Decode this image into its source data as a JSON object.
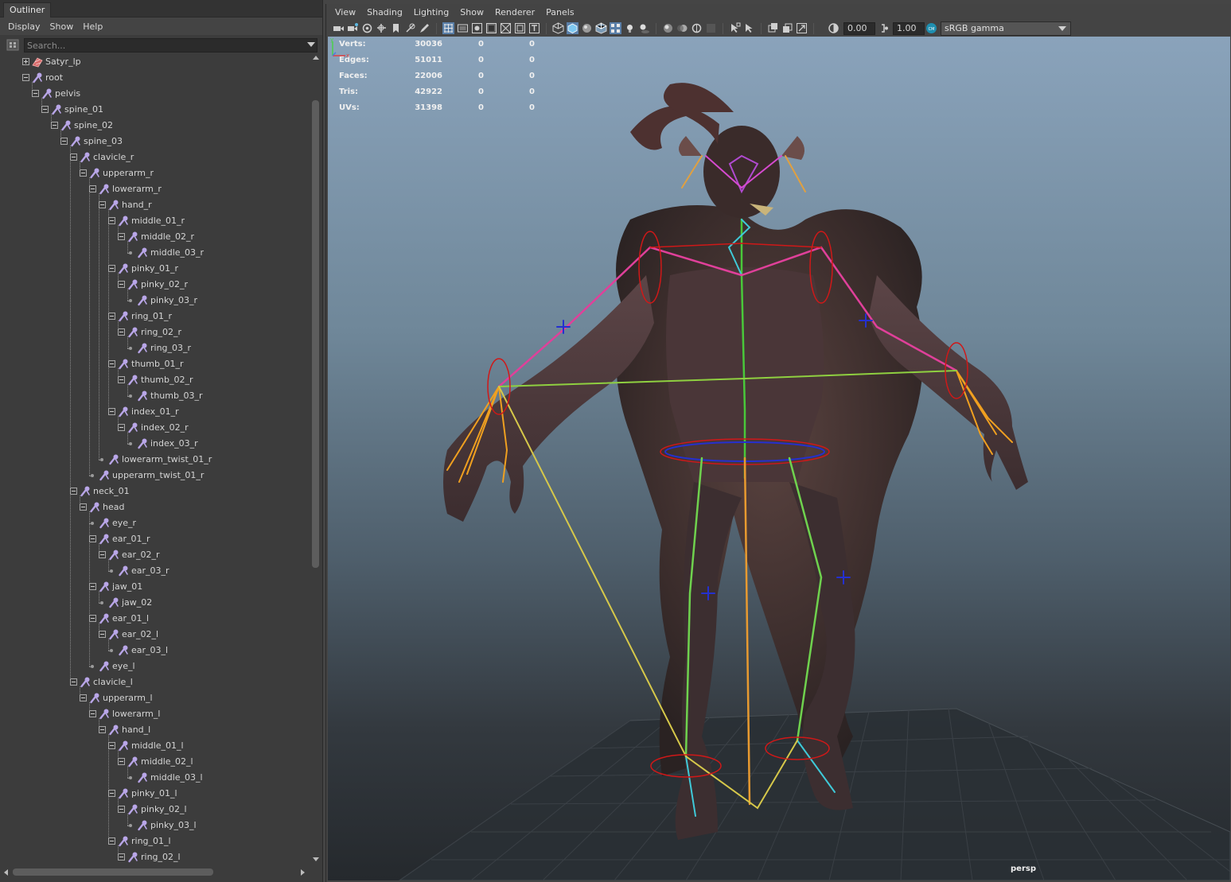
{
  "outliner": {
    "tab_label": "Outliner",
    "menus": [
      "Display",
      "Show",
      "Help"
    ],
    "search_placeholder": "Search...",
    "nodes": [
      {
        "label": "Satyr_lp",
        "type": "mesh",
        "depth": 0,
        "expander": "plus"
      },
      {
        "label": "root",
        "type": "joint",
        "depth": 0,
        "expander": "minus"
      },
      {
        "label": "pelvis",
        "type": "joint",
        "depth": 1,
        "expander": "minus"
      },
      {
        "label": "spine_01",
        "type": "joint",
        "depth": 2,
        "expander": "minus"
      },
      {
        "label": "spine_02",
        "type": "joint",
        "depth": 3,
        "expander": "minus"
      },
      {
        "label": "spine_03",
        "type": "joint",
        "depth": 4,
        "expander": "minus"
      },
      {
        "label": "clavicle_r",
        "type": "joint",
        "depth": 5,
        "expander": "minus"
      },
      {
        "label": "upperarm_r",
        "type": "joint",
        "depth": 6,
        "expander": "minus"
      },
      {
        "label": "lowerarm_r",
        "type": "joint",
        "depth": 7,
        "expander": "minus"
      },
      {
        "label": "hand_r",
        "type": "joint",
        "depth": 8,
        "expander": "minus"
      },
      {
        "label": "middle_01_r",
        "type": "joint",
        "depth": 9,
        "expander": "minus"
      },
      {
        "label": "middle_02_r",
        "type": "joint",
        "depth": 10,
        "expander": "minus"
      },
      {
        "label": "middle_03_r",
        "type": "joint",
        "depth": 11,
        "expander": "leaf"
      },
      {
        "label": "pinky_01_r",
        "type": "joint",
        "depth": 9,
        "expander": "minus"
      },
      {
        "label": "pinky_02_r",
        "type": "joint",
        "depth": 10,
        "expander": "minus"
      },
      {
        "label": "pinky_03_r",
        "type": "joint",
        "depth": 11,
        "expander": "leaf"
      },
      {
        "label": "ring_01_r",
        "type": "joint",
        "depth": 9,
        "expander": "minus"
      },
      {
        "label": "ring_02_r",
        "type": "joint",
        "depth": 10,
        "expander": "minus"
      },
      {
        "label": "ring_03_r",
        "type": "joint",
        "depth": 11,
        "expander": "leaf"
      },
      {
        "label": "thumb_01_r",
        "type": "joint",
        "depth": 9,
        "expander": "minus"
      },
      {
        "label": "thumb_02_r",
        "type": "joint",
        "depth": 10,
        "expander": "minus"
      },
      {
        "label": "thumb_03_r",
        "type": "joint",
        "depth": 11,
        "expander": "leaf"
      },
      {
        "label": "index_01_r",
        "type": "joint",
        "depth": 9,
        "expander": "minus"
      },
      {
        "label": "index_02_r",
        "type": "joint",
        "depth": 10,
        "expander": "minus"
      },
      {
        "label": "index_03_r",
        "type": "joint",
        "depth": 11,
        "expander": "leaf"
      },
      {
        "label": "lowerarm_twist_01_r",
        "type": "joint",
        "depth": 8,
        "expander": "leaf"
      },
      {
        "label": "upperarm_twist_01_r",
        "type": "joint",
        "depth": 7,
        "expander": "leaf"
      },
      {
        "label": "neck_01",
        "type": "joint",
        "depth": 5,
        "expander": "minus"
      },
      {
        "label": "head",
        "type": "joint",
        "depth": 6,
        "expander": "minus"
      },
      {
        "label": "eye_r",
        "type": "joint",
        "depth": 7,
        "expander": "leaf"
      },
      {
        "label": "ear_01_r",
        "type": "joint",
        "depth": 7,
        "expander": "minus"
      },
      {
        "label": "ear_02_r",
        "type": "joint",
        "depth": 8,
        "expander": "minus"
      },
      {
        "label": "ear_03_r",
        "type": "joint",
        "depth": 9,
        "expander": "leaf"
      },
      {
        "label": "jaw_01",
        "type": "joint",
        "depth": 7,
        "expander": "minus"
      },
      {
        "label": "jaw_02",
        "type": "joint",
        "depth": 8,
        "expander": "leaf"
      },
      {
        "label": "ear_01_l",
        "type": "joint",
        "depth": 7,
        "expander": "minus"
      },
      {
        "label": "ear_02_l",
        "type": "joint",
        "depth": 8,
        "expander": "minus"
      },
      {
        "label": "ear_03_l",
        "type": "joint",
        "depth": 9,
        "expander": "leaf"
      },
      {
        "label": "eye_l",
        "type": "joint",
        "depth": 7,
        "expander": "leaf"
      },
      {
        "label": "clavicle_l",
        "type": "joint",
        "depth": 5,
        "expander": "minus"
      },
      {
        "label": "upperarm_l",
        "type": "joint",
        "depth": 6,
        "expander": "minus"
      },
      {
        "label": "lowerarm_l",
        "type": "joint",
        "depth": 7,
        "expander": "minus"
      },
      {
        "label": "hand_l",
        "type": "joint",
        "depth": 8,
        "expander": "minus"
      },
      {
        "label": "middle_01_l",
        "type": "joint",
        "depth": 9,
        "expander": "minus"
      },
      {
        "label": "middle_02_l",
        "type": "joint",
        "depth": 10,
        "expander": "minus"
      },
      {
        "label": "middle_03_l",
        "type": "joint",
        "depth": 11,
        "expander": "leaf"
      },
      {
        "label": "pinky_01_l",
        "type": "joint",
        "depth": 9,
        "expander": "minus"
      },
      {
        "label": "pinky_02_l",
        "type": "joint",
        "depth": 10,
        "expander": "minus"
      },
      {
        "label": "pinky_03_l",
        "type": "joint",
        "depth": 11,
        "expander": "leaf"
      },
      {
        "label": "ring_01_l",
        "type": "joint",
        "depth": 9,
        "expander": "minus"
      },
      {
        "label": "ring_02_l",
        "type": "joint",
        "depth": 10,
        "expander": "minus"
      }
    ]
  },
  "viewport_panel": {
    "menus": [
      "View",
      "Shading",
      "Lighting",
      "Show",
      "Renderer",
      "Panels"
    ],
    "toolbar": {
      "exposure_value": "0.00",
      "gamma_value": "1.00",
      "color_space": "sRGB gamma"
    },
    "hud": {
      "rows": [
        {
          "label": "Verts:",
          "values": [
            "30036",
            "0",
            "0"
          ]
        },
        {
          "label": "Edges:",
          "values": [
            "51011",
            "0",
            "0"
          ]
        },
        {
          "label": "Faces:",
          "values": [
            "22006",
            "0",
            "0"
          ]
        },
        {
          "label": "Tris:",
          "values": [
            "42922",
            "0",
            "0"
          ]
        },
        {
          "label": "UVs:",
          "values": [
            "31398",
            "0",
            "0"
          ]
        }
      ]
    },
    "camera_name": "persp",
    "axis_labels": {
      "y": "y",
      "x": "x"
    }
  },
  "colors": {
    "joint_icon": "#b9a6e8",
    "bone_spine": "#49c83a",
    "bone_arm": "#e0409a",
    "bone_leg": "#6fd24e",
    "ik_handle": "#d6c84a",
    "control_circle": "#d01818",
    "viewport_top": "#8aa3bb",
    "viewport_bottom": "#25292d"
  }
}
